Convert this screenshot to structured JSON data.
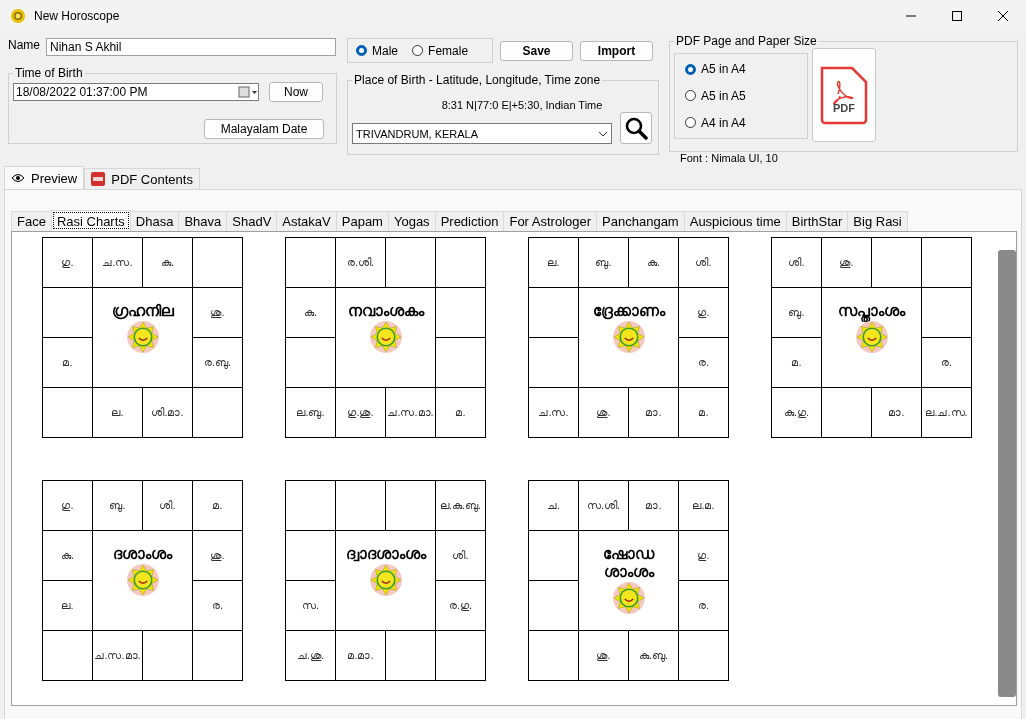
{
  "window": {
    "title": "New Horoscope"
  },
  "name": {
    "label": "Name",
    "value": "Nihan S Akhil"
  },
  "time_of_birth": {
    "title": "Time of Birth",
    "value": "18/08/2022  01:37:00 PM",
    "now_button": "Now",
    "malayalam_date_button": "Malayalam Date"
  },
  "gender": [
    {
      "label": "Male",
      "selected": true
    },
    {
      "label": "Female",
      "selected": false
    }
  ],
  "buttons": [
    "Save",
    "Import"
  ],
  "place_of_birth": {
    "title": "Place of Birth - Latitude, Longitude, Time zone",
    "coordinates": "8:31 N|77:0 E|+5:30, Indian Time",
    "value": "TRIVANDRUM, KERALA"
  },
  "pdf": {
    "title": "PDF Page and Paper Size",
    "sizes": [
      {
        "label": "A5 in A4",
        "selected": true
      },
      {
        "label": "A5 in A5",
        "selected": false
      },
      {
        "label": "A4 in A4",
        "selected": false
      }
    ],
    "button": "PDF",
    "font": "Font : Nimala UI, 10"
  },
  "view_tabs": [
    {
      "label": "Preview",
      "selected": true
    },
    {
      "label": "PDF Contents",
      "selected": false
    }
  ],
  "tabs": [
    {
      "label": "Face",
      "selected": false
    },
    {
      "label": "Rasi Charts",
      "selected": true
    },
    {
      "label": "Dhasa",
      "selected": false
    },
    {
      "label": "Bhava",
      "selected": false
    },
    {
      "label": "ShadV",
      "selected": false
    },
    {
      "label": "AstakaV",
      "selected": false
    },
    {
      "label": "Papam",
      "selected": false
    },
    {
      "label": "Yogas",
      "selected": false
    },
    {
      "label": "Prediction",
      "selected": false
    },
    {
      "label": "For Astrologer",
      "selected": false
    },
    {
      "label": "Panchangam",
      "selected": false
    },
    {
      "label": "Auspicious time",
      "selected": false
    },
    {
      "label": "BirthStar",
      "selected": false
    },
    {
      "label": "Big Rasi",
      "selected": false
    }
  ],
  "charts": [
    {
      "title": "ഗ്രഹനില",
      "houses": [
        {
          "kind": "planets",
          "planets": "ഗു."
        },
        {
          "kind": "planets",
          "planets": "ച.സ."
        },
        {
          "kind": "planets",
          "planets": "കു."
        },
        {
          "kind": "empty"
        },
        {
          "kind": "empty"
        },
        {
          "kind": "planets",
          "planets": "ശു."
        },
        {
          "kind": "planets",
          "planets": "മ."
        },
        {
          "kind": "planets",
          "planets": "ര.ബു."
        },
        {
          "kind": "empty"
        },
        {
          "kind": "planets",
          "planets": "ല."
        },
        {
          "kind": "planets",
          "planets": "ശി.മാ."
        },
        {
          "kind": "empty"
        }
      ]
    },
    {
      "title": "നവാംശകം",
      "houses": [
        {
          "kind": "empty"
        },
        {
          "kind": "planets",
          "planets": "ര.ശി."
        },
        {
          "kind": "empty"
        },
        {
          "kind": "empty"
        },
        {
          "kind": "planets",
          "planets": "കു."
        },
        {
          "kind": "empty"
        },
        {
          "kind": "empty"
        },
        {
          "kind": "empty"
        },
        {
          "kind": "planets",
          "planets": "ല.ബു."
        },
        {
          "kind": "planets",
          "planets": "ഗു.ശു."
        },
        {
          "kind": "planets",
          "planets": "ച.സ.മാ."
        },
        {
          "kind": "planets",
          "planets": "മ."
        }
      ]
    },
    {
      "title": "ദ്രേക്കാണം",
      "houses": [
        {
          "kind": "planets",
          "planets": "ല."
        },
        {
          "kind": "planets",
          "planets": "ബു."
        },
        {
          "kind": "planets",
          "planets": "കു."
        },
        {
          "kind": "planets",
          "planets": "ശി."
        },
        {
          "kind": "empty"
        },
        {
          "kind": "planets",
          "planets": "ഗു."
        },
        {
          "kind": "empty"
        },
        {
          "kind": "planets",
          "planets": "ര."
        },
        {
          "kind": "planets",
          "planets": "ച.സ."
        },
        {
          "kind": "planets",
          "planets": "ശു."
        },
        {
          "kind": "planets",
          "planets": "മാ."
        },
        {
          "kind": "planets",
          "planets": "മ."
        }
      ]
    },
    {
      "title": "സപ്താംശം",
      "houses": [
        {
          "kind": "planets",
          "planets": "ശി."
        },
        {
          "kind": "planets",
          "planets": "ശു."
        },
        {
          "kind": "empty"
        },
        {
          "kind": "empty"
        },
        {
          "kind": "planets",
          "planets": "ബു."
        },
        {
          "kind": "empty"
        },
        {
          "kind": "planets",
          "planets": "മ."
        },
        {
          "kind": "planets",
          "planets": "ര."
        },
        {
          "kind": "planets",
          "planets": "കു.ഗു."
        },
        {
          "kind": "empty"
        },
        {
          "kind": "planets",
          "planets": "മാ."
        },
        {
          "kind": "planets",
          "planets": "ല.ച.സ."
        }
      ]
    },
    {
      "title": "ദശാംശം",
      "houses": [
        {
          "kind": "planets",
          "planets": "ഗു."
        },
        {
          "kind": "planets",
          "planets": "ബു."
        },
        {
          "kind": "planets",
          "planets": "ശി."
        },
        {
          "kind": "planets",
          "planets": "മ."
        },
        {
          "kind": "planets",
          "planets": "കു."
        },
        {
          "kind": "planets",
          "planets": "ശു."
        },
        {
          "kind": "planets",
          "planets": "ല."
        },
        {
          "kind": "planets",
          "planets": "ര."
        },
        {
          "kind": "empty"
        },
        {
          "kind": "planets",
          "planets": "ച.സ.മാ."
        },
        {
          "kind": "empty"
        },
        {
          "kind": "empty"
        }
      ]
    },
    {
      "title": "ദ്വാദശാംശം",
      "houses": [
        {
          "kind": "empty"
        },
        {
          "kind": "empty"
        },
        {
          "kind": "empty"
        },
        {
          "kind": "planets",
          "planets": "ല.കു.ബു."
        },
        {
          "kind": "empty"
        },
        {
          "kind": "planets",
          "planets": "ശി."
        },
        {
          "kind": "planets",
          "planets": "സ."
        },
        {
          "kind": "planets",
          "planets": "ര.ഗു."
        },
        {
          "kind": "planets",
          "planets": "ച.ശു."
        },
        {
          "kind": "planets",
          "planets": "മ.മാ."
        },
        {
          "kind": "empty"
        },
        {
          "kind": "empty"
        }
      ]
    },
    {
      "title": "ഷോഡശാംശം",
      "houses": [
        {
          "kind": "planets",
          "planets": "ച."
        },
        {
          "kind": "planets",
          "planets": "സ.ശി."
        },
        {
          "kind": "planets",
          "planets": "മാ."
        },
        {
          "kind": "planets",
          "planets": "ല.മ."
        },
        {
          "kind": "empty"
        },
        {
          "kind": "planets",
          "planets": "ഗു."
        },
        {
          "kind": "empty"
        },
        {
          "kind": "planets",
          "planets": "ര."
        },
        {
          "kind": "empty"
        },
        {
          "kind": "planets",
          "planets": "ശു."
        },
        {
          "kind": "planets",
          "planets": "കു.ബു."
        },
        {
          "kind": "empty"
        }
      ]
    }
  ]
}
